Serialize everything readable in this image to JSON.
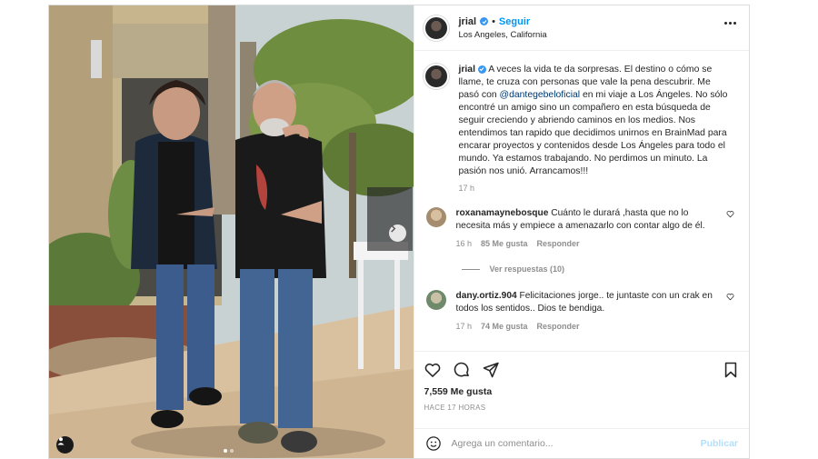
{
  "header": {
    "username": "jrial",
    "follow_label": "Seguir",
    "location": "Los Angeles, California",
    "more_icon": "more-horizontal-icon"
  },
  "caption": {
    "username": "jrial",
    "text_before": "A veces la vida te da sorpresas. El destino o cómo se llame, te cruza con personas que vale la pena descubrir. Me pasó con ",
    "mention": "@dantegebeloficial",
    "text_after": " en mi viaje a Los Ángeles. No sólo encontré un amigo sino un compañero en esta búsqueda de seguir creciendo y abriendo caminos en los medios. Nos entendimos tan rapido que decidimos unirnos en BrainMad para encarar proyectos y contenidos desde Los Ángeles para todo el mundo. Ya estamos trabajando. No perdimos un minuto. La pasión nos unió. Arrancamos!!!",
    "time": "17 h"
  },
  "comments": [
    {
      "username": "roxanamaynebosque",
      "text": "Cuánto le durará ,hasta que no lo necesita más y empiece a amenazarlo con contar algo de él.",
      "time": "16 h",
      "likes": "85 Me gusta",
      "reply": "Responder",
      "view_replies": "Ver respuestas (10)",
      "avatar_color": "#a58c6e"
    },
    {
      "username": "dany.ortiz.904",
      "text": "Felicitaciones jorge.. te juntaste con un crak en todos los sentidos.. Dios te bendiga.",
      "time": "17 h",
      "likes": "74 Me gusta",
      "reply": "Responder",
      "avatar_color": "#6f8a6a"
    }
  ],
  "actions": {
    "icons": [
      "heart-icon",
      "comment-icon",
      "share-icon",
      "bookmark-icon"
    ],
    "likes": "7,559 Me gusta",
    "ago": "HACE 17 HORAS"
  },
  "add_comment": {
    "placeholder": "Agrega un comentario...",
    "publish_label": "Publicar"
  },
  "colors": {
    "accent": "#0095f6",
    "verified": "#3897f0",
    "muted": "#8e8e8e"
  }
}
